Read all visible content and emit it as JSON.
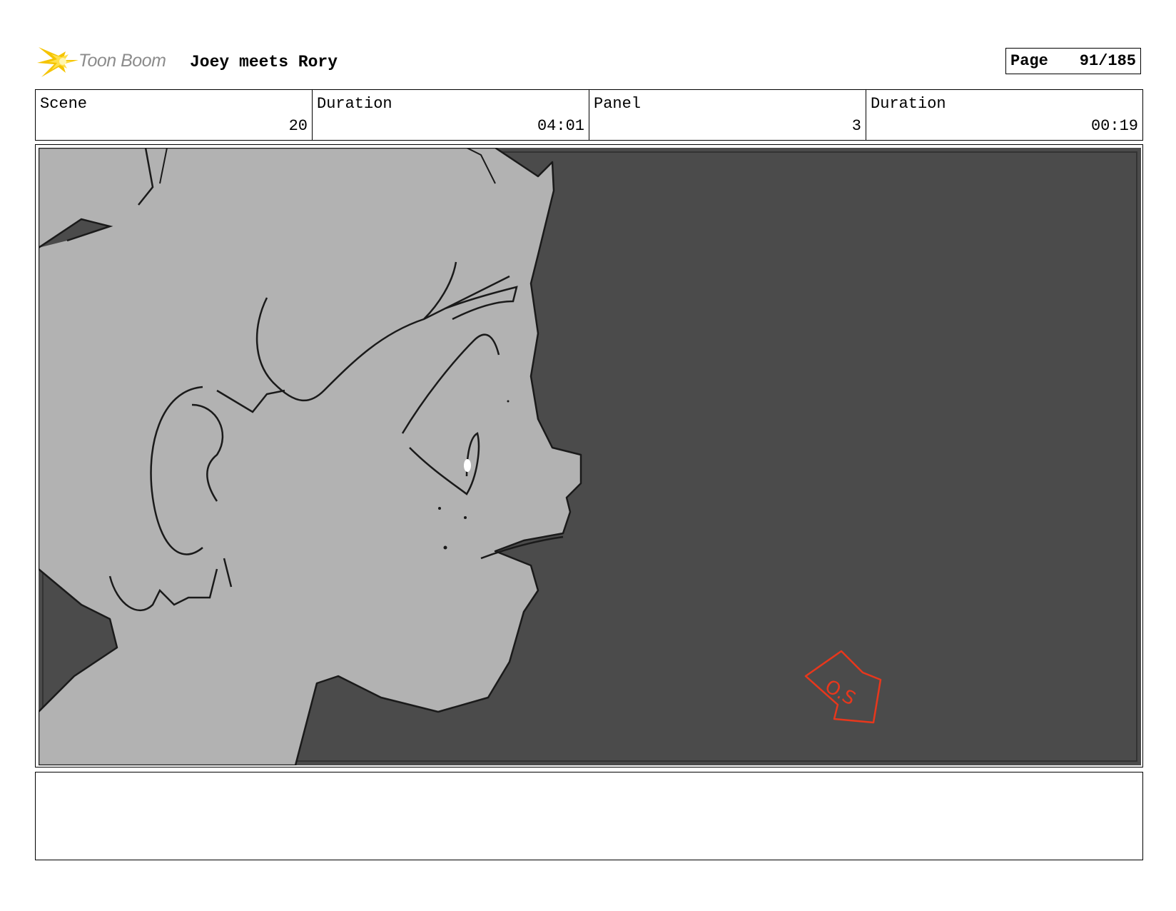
{
  "header": {
    "logo_text": "Toon Boom",
    "title": "Joey meets Rory",
    "page_label": "Page",
    "page_value": "91/185"
  },
  "info": {
    "scene_label": "Scene",
    "scene_value": "20",
    "scene_duration_label": "Duration",
    "scene_duration_value": "04:01",
    "panel_label": "Panel",
    "panel_value": "3",
    "panel_duration_label": "Duration",
    "panel_duration_value": "00:19"
  },
  "panel": {
    "annotation": "O.S",
    "colors": {
      "background": "#4b4b4b",
      "character_fill": "#b2b2b2",
      "annotation": "#e8371c",
      "logo_accent": "#f5c400"
    }
  },
  "notes": {
    "text": ""
  }
}
